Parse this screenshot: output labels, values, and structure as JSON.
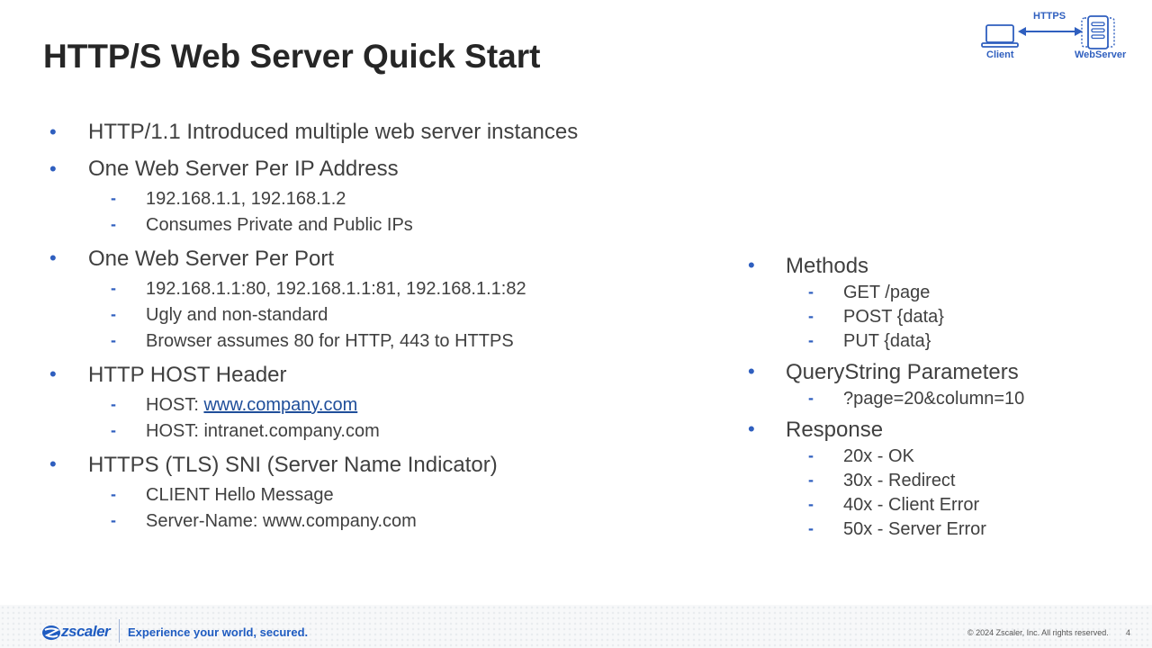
{
  "slide": {
    "title": "HTTP/S Web Server Quick Start",
    "page_number": "4"
  },
  "diagram": {
    "protocol_label": "HTTPS",
    "client_label": "Client",
    "server_label": "WebServer",
    "accent": "#2f5fbf"
  },
  "left": {
    "b1": "HTTP/1.1 Introduced multiple web server instances",
    "b2": "One Web Server Per IP Address",
    "b2_s1": "192.168.1.1, 192.168.1.2",
    "b2_s2": "Consumes Private and Public IPs",
    "b3": "One Web Server Per Port",
    "b3_s1": "192.168.1.1:80, 192.168.1.1:81, 192.168.1.1:82",
    "b3_s2": "Ugly and non-standard",
    "b3_s3": "Browser assumes 80 for HTTP, 443 to HTTPS",
    "b4": "HTTP HOST Header",
    "b4_s1_prefix": "HOST: ",
    "b4_s1_link": "www.company.com",
    "b4_s2": "HOST: intranet.company.com",
    "b5": "HTTPS (TLS) SNI (Server Name Indicator)",
    "b5_s1": "CLIENT Hello Message",
    "b5_s2": "Server-Name: www.company.com"
  },
  "right": {
    "b1": "Methods",
    "b1_s1": "GET /page",
    "b1_s2": "POST {data}",
    "b1_s3": "PUT {data}",
    "b2": "QueryString Parameters",
    "b2_s1": "?page=20&column=10",
    "b3": "Response",
    "b3_s1": "20x - OK",
    "b3_s2": "30x - Redirect",
    "b3_s3": "40x - Client Error",
    "b3_s4": "50x - Server Error"
  },
  "footer": {
    "logo_text": "zscaler",
    "tagline": "Experience your world, secured.",
    "copyright": "© 2024  Zscaler, Inc. All rights reserved.",
    "brand_color": "#1f5cc1"
  },
  "icons": {
    "client": "laptop-icon",
    "server": "server-icon",
    "arrow": "double-arrow-icon",
    "bullet": "bullet-dot",
    "sub_bullet": "dash"
  }
}
